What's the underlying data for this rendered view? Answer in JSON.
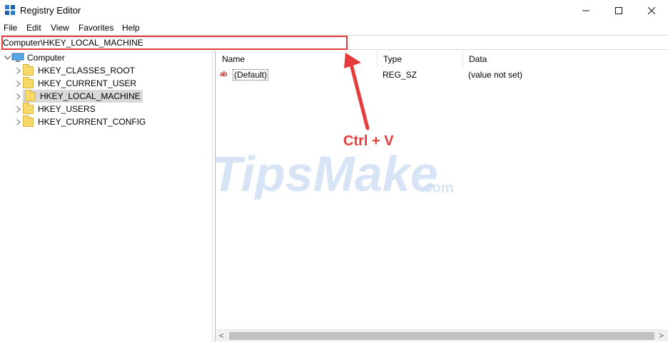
{
  "window": {
    "title": "Registry Editor",
    "minimize_label": "—",
    "maximize_label": "☐",
    "close_label": "✕"
  },
  "menu": {
    "items": [
      "File",
      "Edit",
      "View",
      "Favorites",
      "Help"
    ]
  },
  "address": {
    "value": "Computer\\HKEY_LOCAL_MACHINE"
  },
  "tree": {
    "root": "Computer",
    "children": [
      {
        "label": "HKEY_CLASSES_ROOT",
        "selected": false
      },
      {
        "label": "HKEY_CURRENT_USER",
        "selected": false
      },
      {
        "label": "HKEY_LOCAL_MACHINE",
        "selected": true
      },
      {
        "label": "HKEY_USERS",
        "selected": false
      },
      {
        "label": "HKEY_CURRENT_CONFIG",
        "selected": false
      }
    ]
  },
  "list": {
    "columns": [
      "Name",
      "Type",
      "Data"
    ],
    "rows": [
      {
        "name": "(Default)",
        "type": "REG_SZ",
        "data": "(value not set)"
      }
    ]
  },
  "annotation": {
    "text": "Ctrl + V",
    "color": "#e53b3b"
  },
  "watermark": {
    "brand": "TipsMake",
    "suffix": ".com"
  },
  "scrollbar": {
    "left_arrow": "<",
    "right_arrow": ">"
  }
}
